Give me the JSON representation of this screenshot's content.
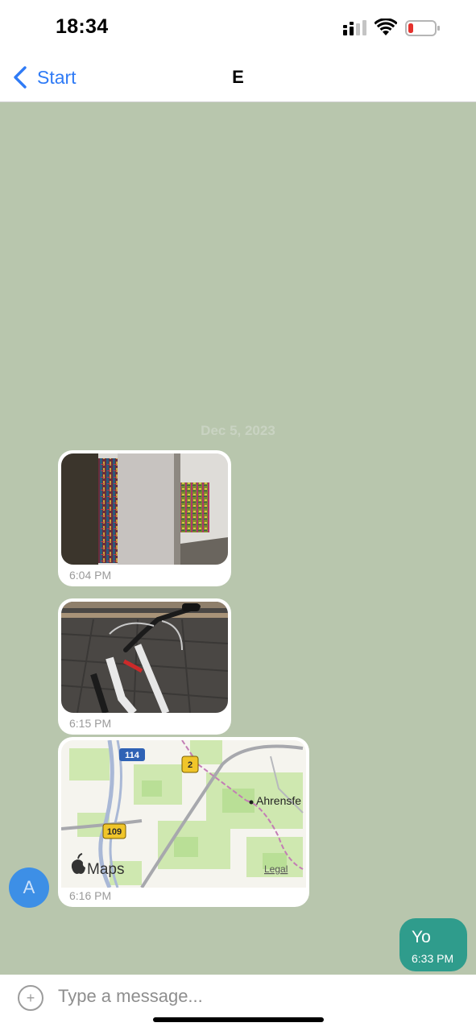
{
  "status_bar": {
    "time": "18:34",
    "icons": [
      "cellular-signal-icon",
      "wifi-icon",
      "battery-low-icon"
    ],
    "battery_color": "#e5322d"
  },
  "nav": {
    "back_label": "Start",
    "title": "E",
    "accent_color": "#2f7bf6"
  },
  "chat": {
    "background_color": "#b8c6ad",
    "date_separator": "Dec 5, 2023",
    "messages": [
      {
        "type": "image",
        "subject": "gallery-photo",
        "time": "6:04 PM"
      },
      {
        "type": "image",
        "subject": "bicycle-photo",
        "time": "6:15 PM"
      },
      {
        "type": "map",
        "time": "6:16 PM",
        "map_labels": {
          "road_114": "114",
          "road_2": "2",
          "road_109": "109",
          "place": "Ahrensfe",
          "brand": "Maps",
          "legal": "Legal"
        }
      },
      {
        "type": "text",
        "direction": "outgoing",
        "text": "Yo",
        "time": "6:33 PM",
        "bubble_color": "#2f9c8c"
      }
    ],
    "avatar_initial": "A",
    "avatar_color": "#3d8fe6"
  },
  "input": {
    "placeholder": "Type a message...",
    "value": ""
  }
}
